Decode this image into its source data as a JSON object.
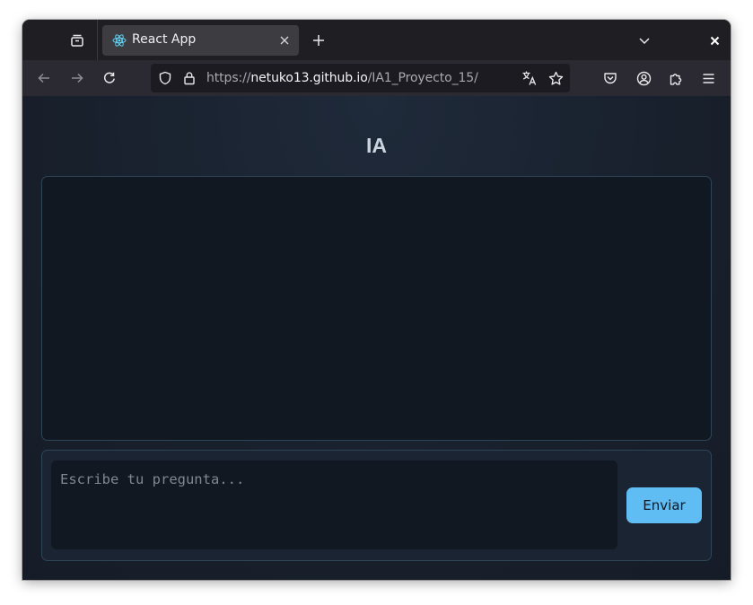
{
  "browser": {
    "tab": {
      "title": "React App"
    },
    "url": {
      "prefix": "https://",
      "host": "netuko13.github.io",
      "path": "/IA1_Proyecto_15/"
    }
  },
  "page": {
    "title": "IA",
    "input": {
      "value": "",
      "placeholder": "Escribe tu pregunta..."
    },
    "send_label": "Enviar"
  },
  "icons": {
    "tab_tray": "collection-icon",
    "favicon": "react-logo-icon",
    "tab_close": "close-icon",
    "new_tab": "plus-icon",
    "tab_list": "chevron-down-icon",
    "window_close": "close-icon",
    "back": "arrow-left-icon",
    "forward": "arrow-right-icon",
    "reload": "reload-icon",
    "tracking": "shield-icon",
    "lock": "lock-icon",
    "translate": "translate-icon",
    "bookmark": "star-icon",
    "pocket": "pocket-icon",
    "account": "account-icon",
    "extensions": "puzzle-icon",
    "menu": "hamburger-icon"
  },
  "colors": {
    "accent": "#5fbdf3",
    "page_background": "#18202c",
    "panel_border": "#2d4556"
  }
}
